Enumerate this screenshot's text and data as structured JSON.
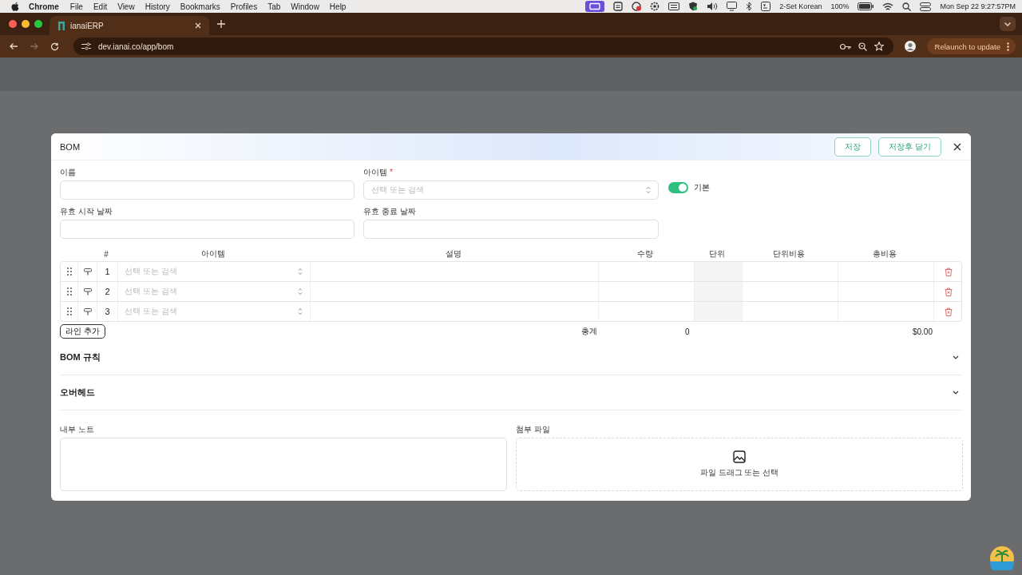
{
  "menubar": {
    "app": "Chrome",
    "menus": [
      "File",
      "Edit",
      "View",
      "History",
      "Bookmarks",
      "Profiles",
      "Tab",
      "Window",
      "Help"
    ],
    "input_source": "2-Set Korean",
    "battery": "100%",
    "clock": "Mon Sep 22  9:27:57PM"
  },
  "browser": {
    "tab_title": "ianaiERP",
    "url": "dev.ianai.co/app/bom",
    "relaunch": "Relaunch to update"
  },
  "modal": {
    "title": "BOM",
    "buttons": [
      {
        "label": "저장"
      },
      {
        "label": "저장후 닫기"
      }
    ],
    "name_field": {
      "label": "이름"
    },
    "item_field": {
      "label": "아이템",
      "required_mark": "*",
      "placeholder": "선택 또는 검색"
    },
    "default_toggle": {
      "label": "기본",
      "on": true
    },
    "start_date_field": {
      "label": "유효 시작 날짜"
    },
    "end_date_field": {
      "label": "유효 종료 날짜"
    },
    "lines_table": {
      "columns": [
        "#",
        "아이템",
        "설명",
        "수량",
        "단위",
        "단위비용",
        "총비용"
      ],
      "rows": [
        {
          "number": "1",
          "item_placeholder": "선택 또는 검색"
        },
        {
          "number": "2",
          "item_placeholder": "선택 또는 검색"
        },
        {
          "number": "3",
          "item_placeholder": "선택 또는 검색"
        }
      ],
      "add_line": "라인 추가",
      "total_label": "총계",
      "total_quantity": "0",
      "total_cost": "$0.00"
    },
    "sections": [
      {
        "title": "BOM 규칙",
        "expanded": false
      },
      {
        "title": "오버헤드",
        "expanded": false
      }
    ],
    "notes": {
      "label": "내부 노트"
    },
    "attachments": {
      "label": "첨부 파일",
      "dropzone_text": "파일 드래그 또는 선택"
    }
  }
}
